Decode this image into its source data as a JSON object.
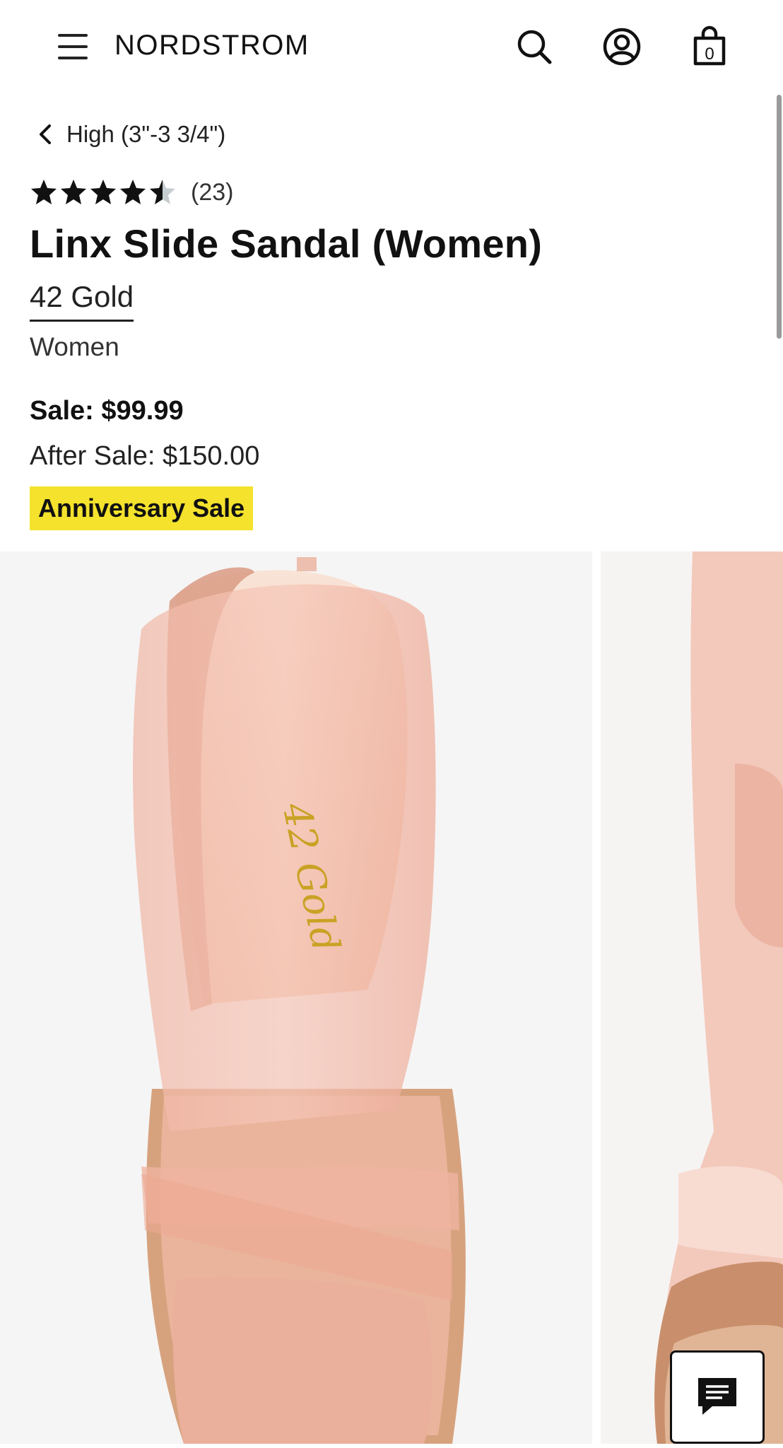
{
  "header": {
    "logo": "NORDSTROM",
    "menu_icon": "hamburger-menu-icon",
    "search_icon": "search-icon",
    "account_icon": "account-icon",
    "bag_icon": "shopping-bag-icon",
    "bag_count": "0"
  },
  "breadcrumb": {
    "label": "High (3\"-3 3/4\")",
    "icon": "chevron-left-icon"
  },
  "product": {
    "rating": 4.5,
    "review_count": "(23)",
    "title": "Linx Slide Sandal (Women)",
    "brand": "42 Gold",
    "gender": "Women",
    "sale_price": "Sale: $99.99",
    "after_sale_price": "After Sale: $150.00",
    "badge": "Anniversary Sale"
  },
  "gallery": {
    "insole_logo": "42 Gold"
  },
  "chat": {
    "icon": "chat-icon"
  },
  "colors": {
    "badge_bg": "#f4e22d",
    "text": "#111111",
    "star_filled": "#111111",
    "star_empty": "#c7ced1"
  }
}
